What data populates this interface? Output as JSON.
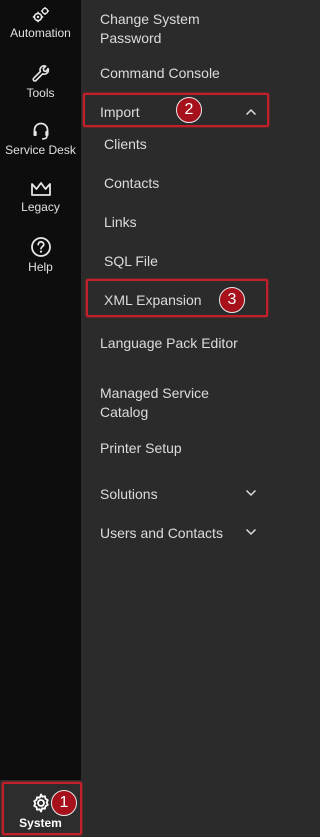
{
  "rail": {
    "items": [
      {
        "label": "Automation",
        "icon": "automation-gears-icon"
      },
      {
        "label": "Tools",
        "icon": "wrench-icon"
      },
      {
        "label": "Service Desk",
        "icon": "headset-icon"
      },
      {
        "label": "Legacy",
        "icon": "crown-icon"
      },
      {
        "label": "Help",
        "icon": "help-circle-icon"
      }
    ],
    "system": {
      "label": "System",
      "icon": "gear-icon"
    }
  },
  "menu": {
    "change_password": "Change System Password",
    "command_console": "Command Console",
    "import": "Import",
    "import_items": [
      "Clients",
      "Contacts",
      "Links",
      "SQL File",
      "XML Expansion"
    ],
    "language_pack_editor": "Language Pack Editor",
    "managed_service_catalog": "Managed Service Catalog",
    "printer_setup": "Printer Setup",
    "solutions": "Solutions",
    "users_and_contacts": "Users and Contacts"
  },
  "callouts": {
    "system": "1",
    "import": "2",
    "xml_expansion": "3"
  },
  "colors": {
    "highlight": "#c4202c",
    "badge": "#a6111c",
    "rail_bg": "#0d0d0d",
    "panel_bg": "#2b2b2b"
  }
}
